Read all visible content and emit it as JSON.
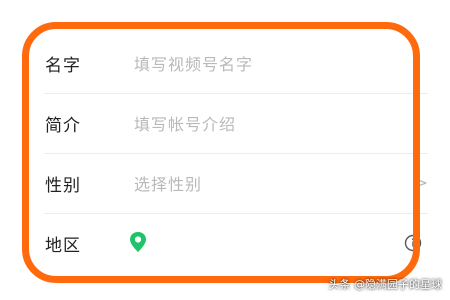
{
  "form": {
    "rows": [
      {
        "label": "名字",
        "placeholder": "填写视频号名字"
      },
      {
        "label": "简介",
        "placeholder": "填写帐号介绍"
      },
      {
        "label": "性别",
        "placeholder": "选择性别",
        "icon": "chevron-right-icon"
      },
      {
        "label": "地区",
        "icon": "location-pin-icon",
        "trailing_icon": "info-icon"
      }
    ]
  },
  "colors": {
    "highlight": "#ff6a0d",
    "pin": "#1ec46a",
    "label": "#222222",
    "placeholder": "#b9b9b9"
  },
  "watermark": "头条 @隐满园子的星球"
}
